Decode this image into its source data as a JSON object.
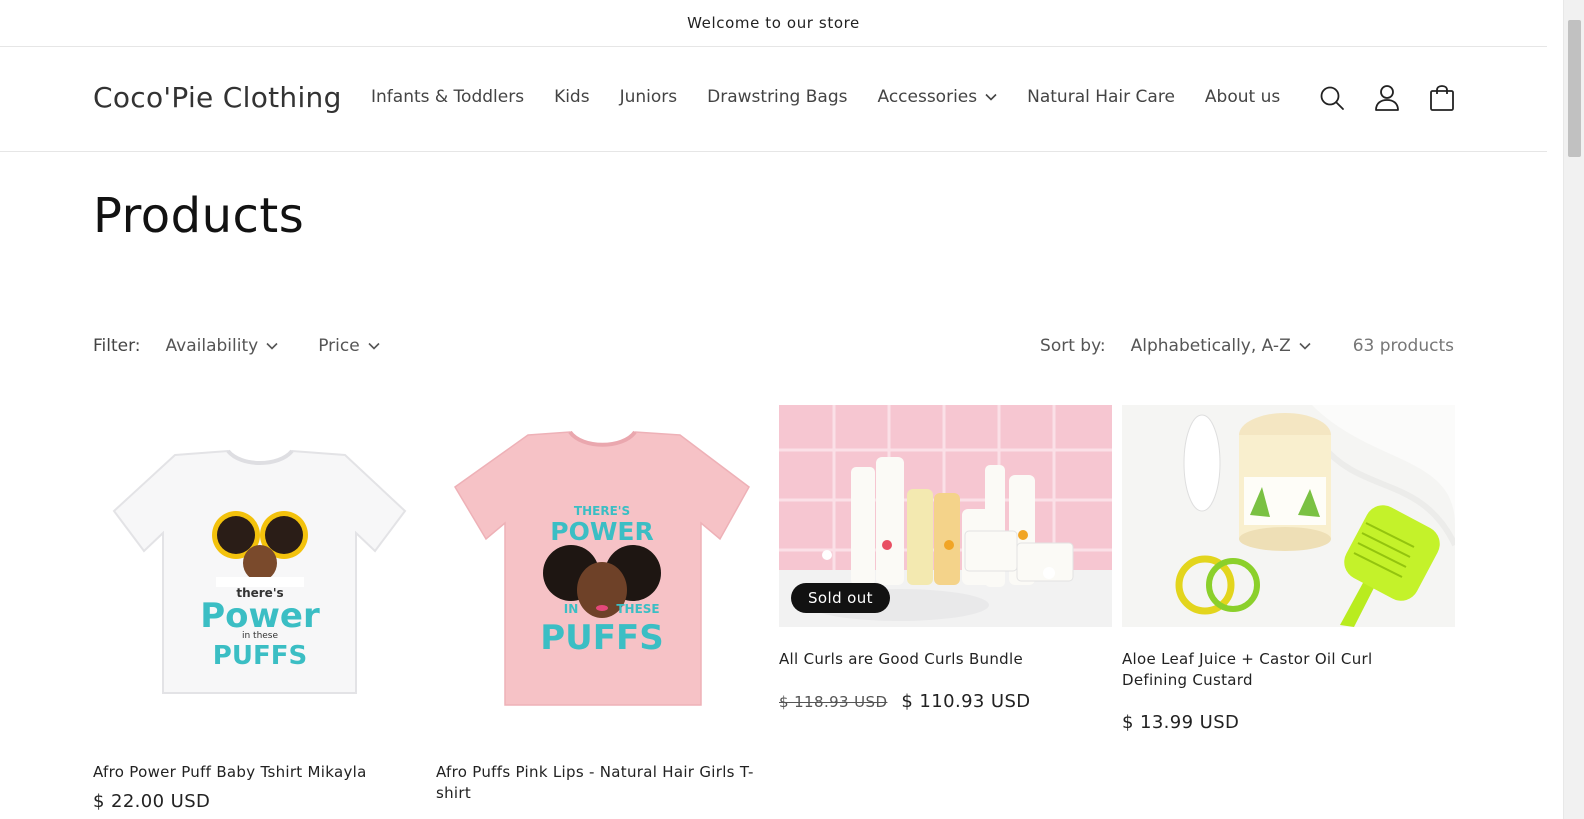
{
  "announcement": {
    "text": "Welcome to our store"
  },
  "header": {
    "logo": "Coco'Pie Clothing",
    "nav": [
      {
        "label": "Infants & Toddlers"
      },
      {
        "label": "Kids"
      },
      {
        "label": "Juniors"
      },
      {
        "label": "Drawstring Bags"
      },
      {
        "label": "Accessories",
        "has_dropdown": true
      },
      {
        "label": "Natural Hair Care"
      },
      {
        "label": "About us"
      }
    ],
    "icons": [
      "search-icon",
      "account-icon",
      "cart-icon"
    ]
  },
  "page": {
    "title": "Products"
  },
  "filters": {
    "label": "Filter:",
    "availability": "Availability",
    "price": "Price",
    "sort_label": "Sort by:",
    "sort_value": "Alphabetically, A-Z",
    "count": "63 products"
  },
  "products": [
    {
      "title": "Afro Power Puff Baby Tshirt Mikayla",
      "price": "$ 22.00 USD"
    },
    {
      "title": "Afro Puffs Pink Lips - Natural Hair Girls T-shirt",
      "price": ""
    },
    {
      "title": "All Curls are Good Curls Bundle",
      "old_price": "$ 118.93 USD",
      "price": "$ 110.93 USD",
      "badge": "Sold out"
    },
    {
      "title": "Aloe Leaf Juice + Castor Oil Curl Defining Custard",
      "price": "$ 13.99 USD"
    }
  ],
  "colors": {
    "text": "#121212",
    "badge_bg": "#121212",
    "tee_pink": "#f6c2c6",
    "tile_pink": "#f6c6d1",
    "accent_teal": "#3bbec4",
    "brush_green": "#b9ec1f"
  }
}
